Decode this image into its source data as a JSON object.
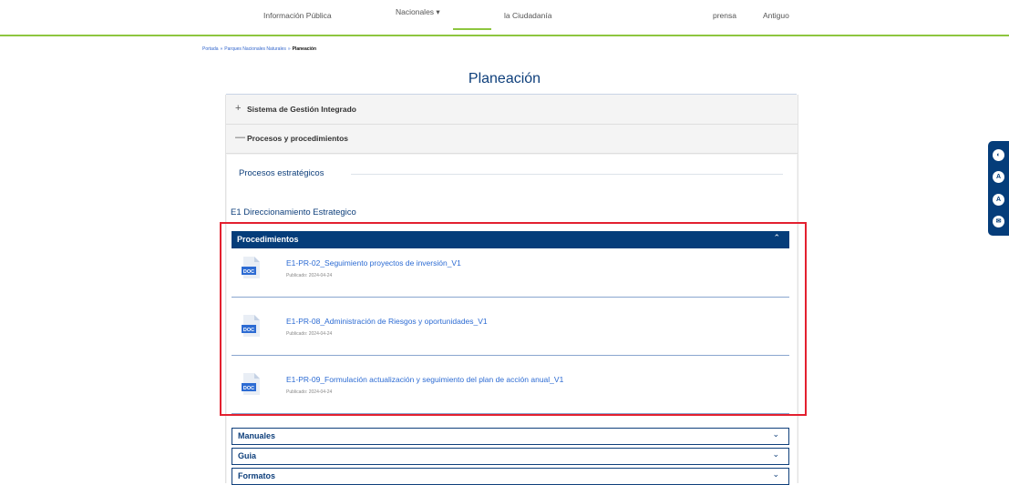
{
  "nav": {
    "items": [
      "Información Pública",
      "Nacionales ▾",
      "la Ciudadanía",
      "prensa",
      "Antiguo"
    ]
  },
  "breadcrumb": {
    "home": "Portada",
    "parent": "Parques Nacionales Naturales",
    "current": "Planeación",
    "separator": "»"
  },
  "page": {
    "title": "Planeación"
  },
  "accordion": {
    "sistema": {
      "symbol": "+",
      "label": "Sistema de Gestión Integrado"
    },
    "procesos": {
      "symbol": "—",
      "label": "Procesos y procedimientos"
    }
  },
  "content": {
    "section_title": "Procesos estratégicos",
    "group_title": "E1 Direccionamiento Estrategico"
  },
  "procedimientos": {
    "label": "Procedimientos",
    "chevron": "⌃",
    "items": [
      {
        "title": "E1-PR-02_Seguimiento proyectos de inversión_V1",
        "date": "Publicado: 2024-04-24",
        "icon": "DOC"
      },
      {
        "title": "E1-PR-08_Administración de Riesgos y oportunidades_V1",
        "date": "Publicado: 2024-04-24",
        "icon": "DOC"
      },
      {
        "title": "E1-PR-09_Formulación actualización y seguimiento del plan de acción anual_V1",
        "date": "Publicado: 2024-04-24",
        "icon": "DOC"
      }
    ]
  },
  "collapsed_sections": [
    {
      "label": "Manuales",
      "chevron": "⌄"
    },
    {
      "label": "Guia",
      "chevron": "⌄"
    },
    {
      "label": "Formatos",
      "chevron": "⌄"
    }
  ],
  "accessibility": {
    "buttons": [
      {
        "icon": "contrast-icon",
        "glyph": "◐"
      },
      {
        "icon": "font-increase-icon",
        "glyph": "A"
      },
      {
        "icon": "font-decrease-icon",
        "glyph": "A"
      },
      {
        "icon": "chat-icon",
        "glyph": "✉"
      }
    ]
  },
  "colors": {
    "primary": "#053d7a",
    "accent_green": "#8dc63f",
    "link": "#2c6bd3",
    "highlight": "#e3202f"
  }
}
